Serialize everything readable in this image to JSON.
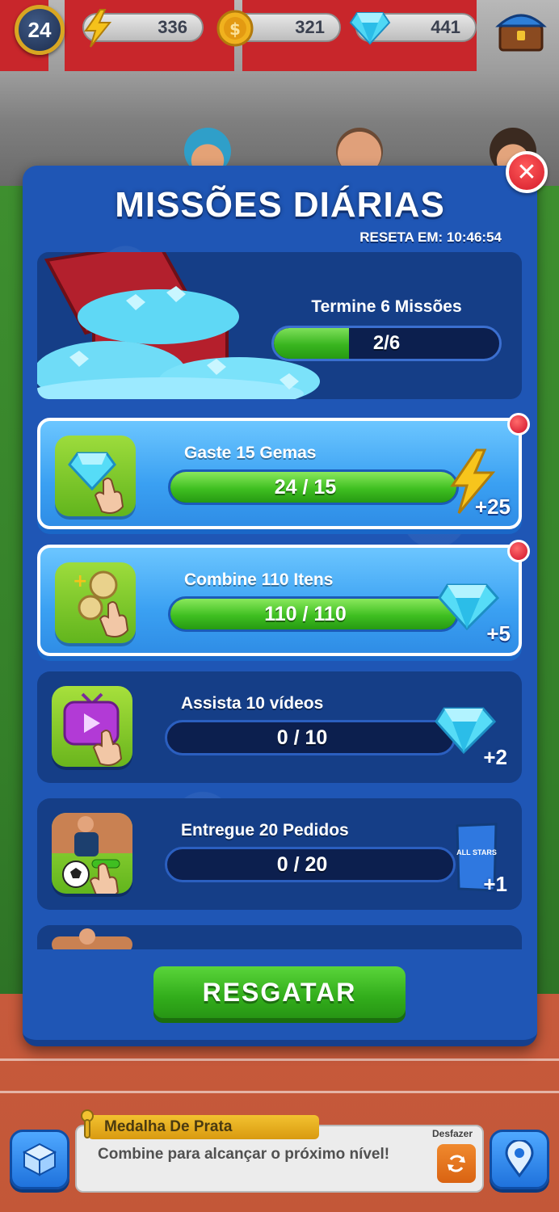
{
  "hud": {
    "level": "24",
    "energy": "336",
    "coins": "321",
    "gems": "441",
    "icons": {
      "energy": "lightning-icon",
      "coins": "coin-icon",
      "gems": "gem-icon",
      "shop": "shop-chest-icon"
    }
  },
  "modal": {
    "title": "MISSÕES DIÁRIAS",
    "reset": "RESETA EM: 10:46:54",
    "hero": {
      "label": "Termine 6 Missões",
      "progress_text": "2/6",
      "progress": 0.333
    },
    "missions": [
      {
        "label": "Gaste 15 Gemas",
        "progress_text": "24 / 15",
        "progress": 1.0,
        "reward": "+25",
        "reward_icon": "lightning-icon",
        "state": "complete",
        "icon": "gem-tap-icon"
      },
      {
        "label": "Combine 110 Itens",
        "progress_text": "110 / 110",
        "progress": 1.0,
        "reward": "+5",
        "reward_icon": "gem-icon",
        "state": "complete",
        "icon": "merge-coins-icon"
      },
      {
        "label": "Assista 10 vídeos",
        "progress_text": "0 / 10",
        "progress": 0.0,
        "reward": "+2",
        "reward_icon": "gem-icon",
        "state": "open",
        "icon": "tv-video-icon"
      },
      {
        "label": "Entregue 20 Pedidos",
        "progress_text": "0 / 20",
        "progress": 0.0,
        "reward": "+1",
        "reward_icon": "card-pack-icon",
        "reward_pack_text": "ALL STARS",
        "state": "open",
        "icon": "player-order-icon"
      }
    ],
    "claim_label": "RESGATAR"
  },
  "bottom": {
    "medal": "Medalha De Prata",
    "hint": "Combine para alcançar o próximo nível!",
    "undo_label": "Desfazer"
  },
  "colors": {
    "modal_blue": "#1f56b5",
    "panel_navy": "#153e87",
    "progress_green": "#3fbf21",
    "complete_card": "#3aa0f2",
    "close_red": "#d41b2a",
    "medal_gold": "#f2c230"
  }
}
